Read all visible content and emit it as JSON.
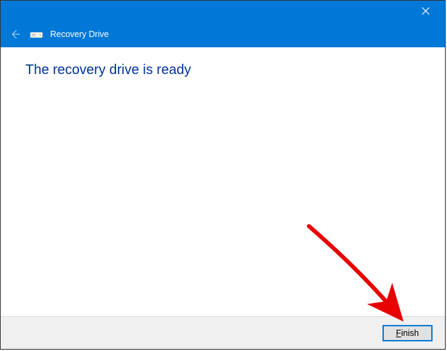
{
  "titlebar": {
    "close_name": "close-icon"
  },
  "header": {
    "back_name": "back-arrow-icon",
    "drive_name": "drive-icon",
    "title": "Recovery Drive"
  },
  "content": {
    "message": "The recovery drive is ready"
  },
  "footer": {
    "finish_mnemonic": "F",
    "finish_rest": "inish"
  }
}
